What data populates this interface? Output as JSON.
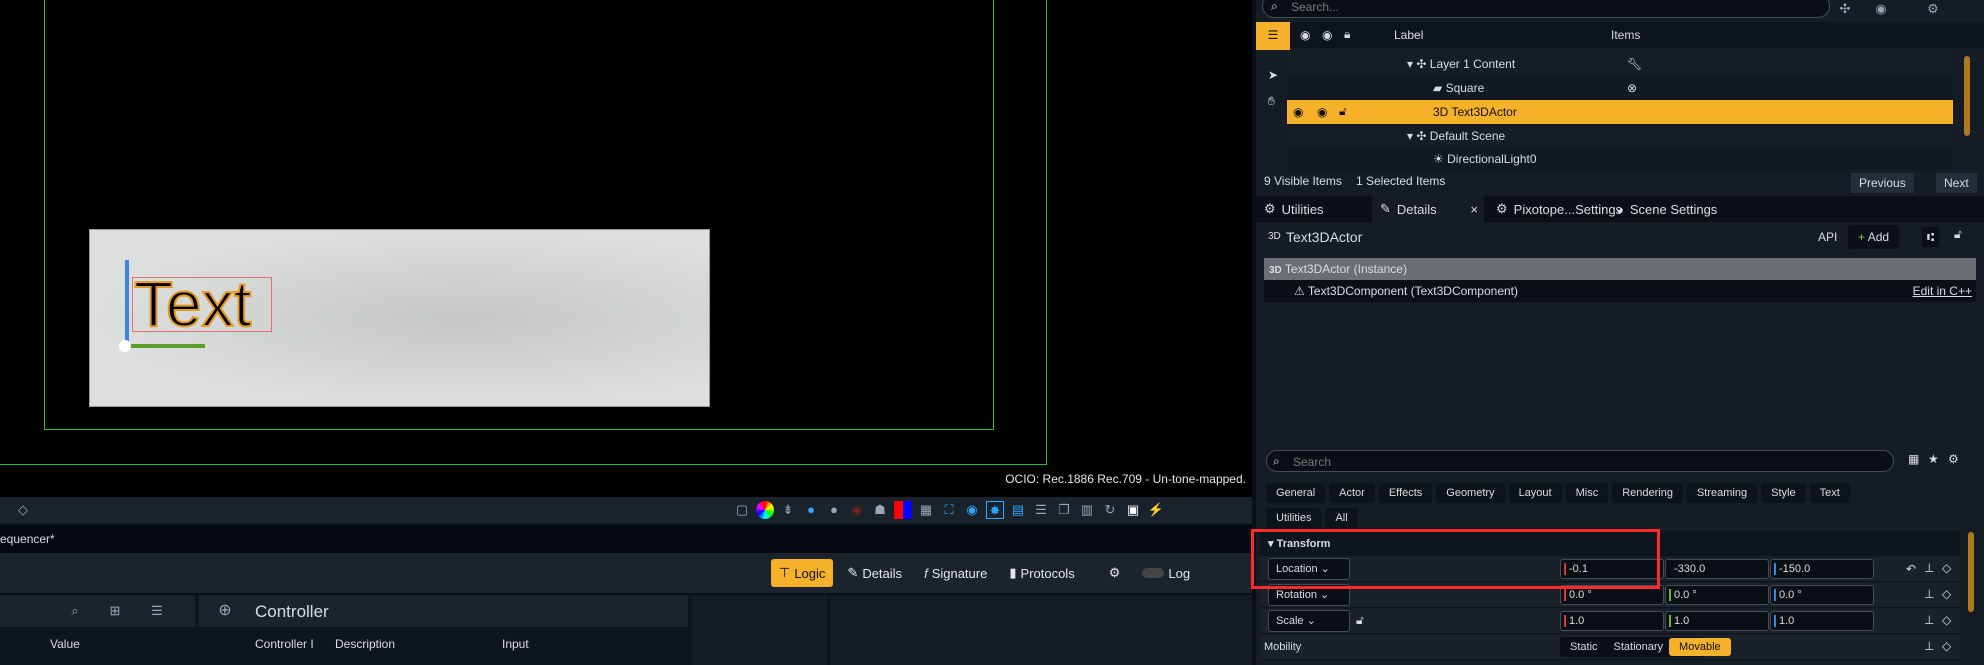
{
  "viewport": {
    "text_label": "Text",
    "ocio": "OCIO: Rec.1886 Rec.709 - Un-tone-mapped."
  },
  "toolbar": {
    "icons": [
      "diamond-icon",
      "shape-icon",
      "color-wheel-icon",
      "exposure-icon",
      "blue-balance-icon",
      "gray-balance-icon",
      "eye-off-icon",
      "gamepad-icon",
      "rgb-icon",
      "grid-icon",
      "frame-icon",
      "eye-icon",
      "sun-icon",
      "panel-icon",
      "filter-icon",
      "layers-icon",
      "table-icon",
      "rotate-icon",
      "image-icon",
      "lightning-icon"
    ]
  },
  "sequencer": {
    "tab": "equencer*"
  },
  "logic_bar": {
    "buttons": [
      "Logic",
      "Details",
      "Signature",
      "Protocols"
    ],
    "log": "Log"
  },
  "controller": {
    "title": "Controller",
    "columns_left": [
      "Value"
    ],
    "columns": [
      "Controller I",
      "Description",
      "Input"
    ]
  },
  "outliner": {
    "search_placeholder": "Search...",
    "col_label": "Label",
    "col_items": "Items",
    "rows": [
      {
        "label": "Layer 1 Content"
      },
      {
        "label": "Square"
      },
      {
        "label": "Text3DActor"
      },
      {
        "label": "Default Scene"
      },
      {
        "label": "DirectionalLight0"
      }
    ],
    "visible": "9  Visible Items",
    "selected": "1  Selected Items",
    "previous": "Previous",
    "next": "Next"
  },
  "tabs": [
    "Utilities",
    "Details",
    "Pixotope...Settings",
    "Scene Settings"
  ],
  "details": {
    "badge": "3D",
    "title": "Text3DActor",
    "api": "API",
    "add": "Add",
    "instance": "Text3DActor (Instance)",
    "component": "Text3DComponent (Text3DComponent)",
    "edit": "Edit in C++",
    "search_placeholder": "Search",
    "categories": [
      "General",
      "Actor",
      "Effects",
      "Geometry",
      "Layout",
      "Misc",
      "Rendering",
      "Streaming",
      "Style",
      "Text",
      "Utilities",
      "All"
    ],
    "section": "Transform",
    "location": {
      "label": "Location",
      "x": "-0.1",
      "y": "-330.0",
      "z": "-150.0"
    },
    "rotation": {
      "label": "Rotation",
      "x": "0.0 °",
      "y": "0.0 °",
      "z": "0.0 °"
    },
    "scale": {
      "label": "Scale",
      "x": "1.0",
      "y": "1.0",
      "z": "1.0"
    },
    "mobility": {
      "label": "Mobility",
      "options": [
        "Static",
        "Stationary",
        "Movable"
      ],
      "selected": "Movable"
    }
  },
  "colors": {
    "accent": "#f5b129",
    "x_axis": "#d93a2e",
    "y_axis": "#6ab52e",
    "z_axis": "#3a86e0",
    "highlight_box": "#ff2a2a"
  }
}
